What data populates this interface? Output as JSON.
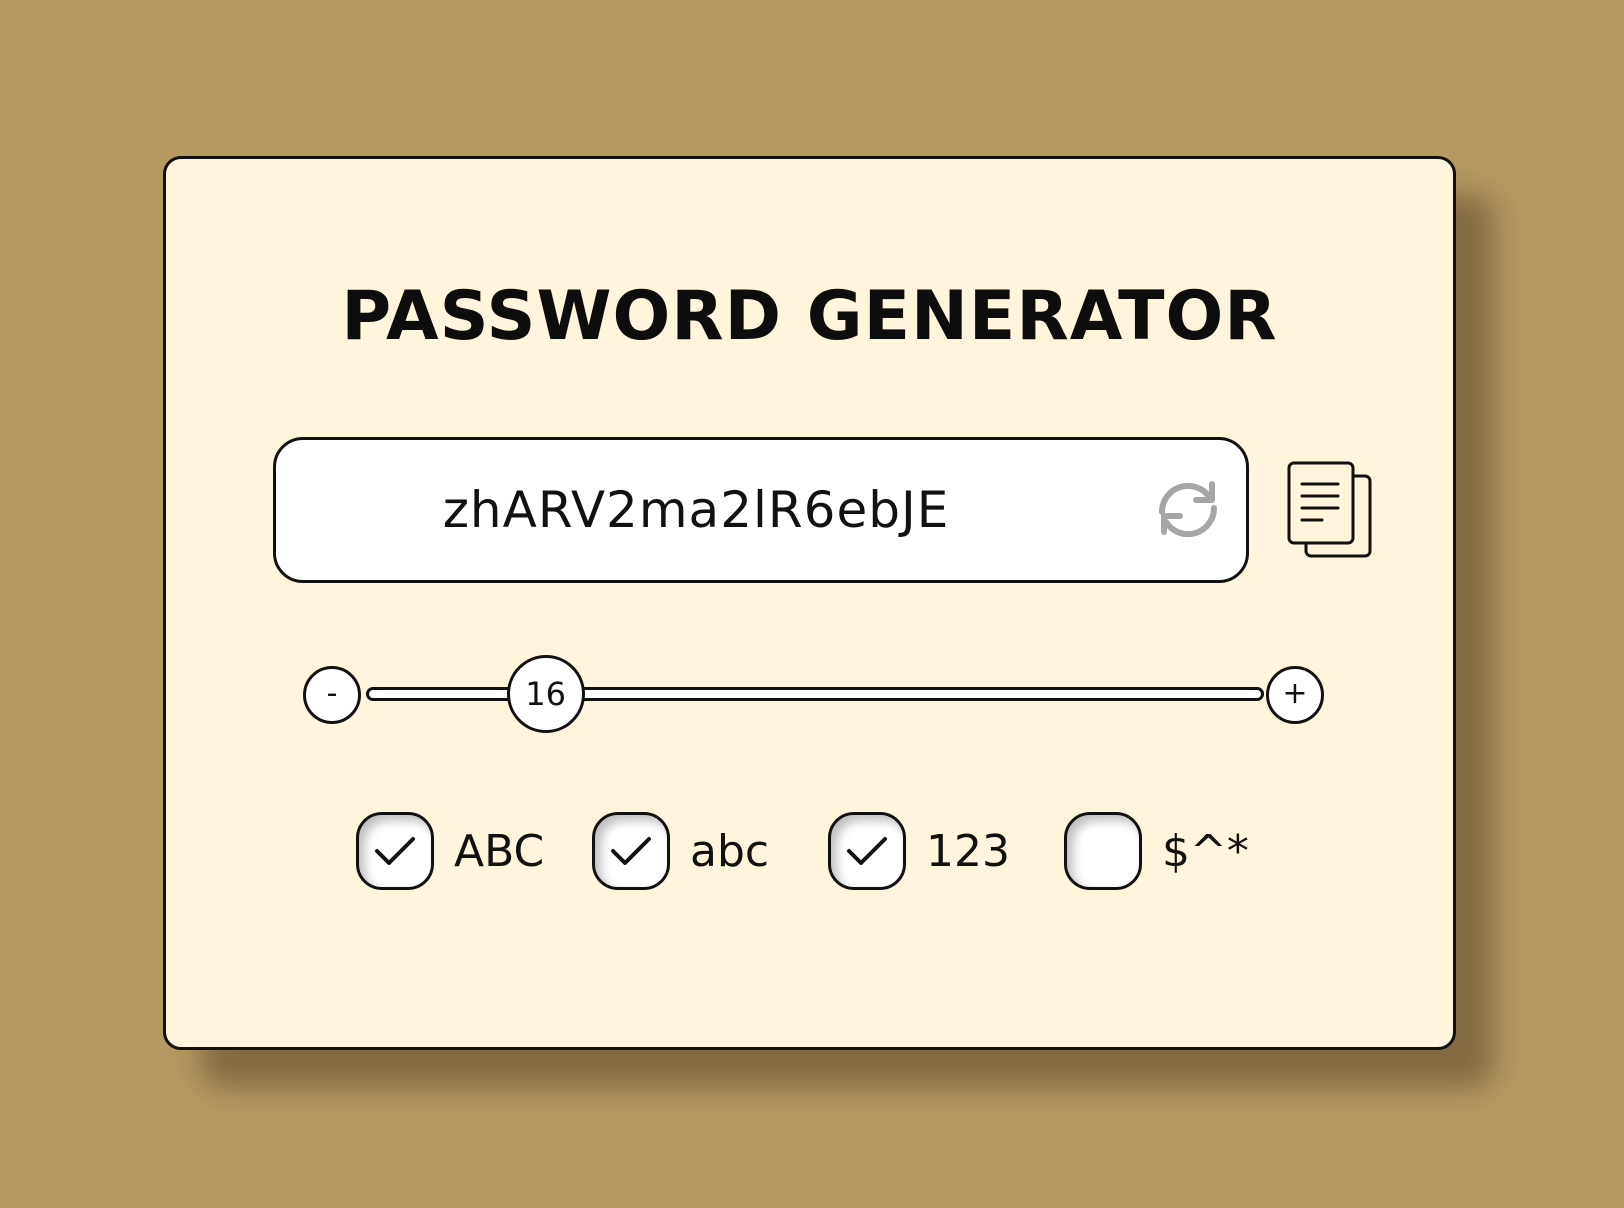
{
  "app": {
    "title": "PASSWORD GENERATOR"
  },
  "password": {
    "value": "zhARV2ma2lR6ebJE"
  },
  "icons": {
    "refresh": "refresh-icon",
    "copy": "copy-icon"
  },
  "length": {
    "value": 16,
    "min": 4,
    "max": 64,
    "decrement_label": "-",
    "increment_label": "+"
  },
  "options": [
    {
      "label": "ABC",
      "checked": true
    },
    {
      "label": "abc",
      "checked": true
    },
    {
      "label": "123",
      "checked": true
    },
    {
      "label": "$^*",
      "checked": false
    }
  ],
  "colors": {
    "background": "#b59b61",
    "card": "#fff4dc",
    "ink": "#111111",
    "refresh_icon": "#a6a6a6"
  }
}
